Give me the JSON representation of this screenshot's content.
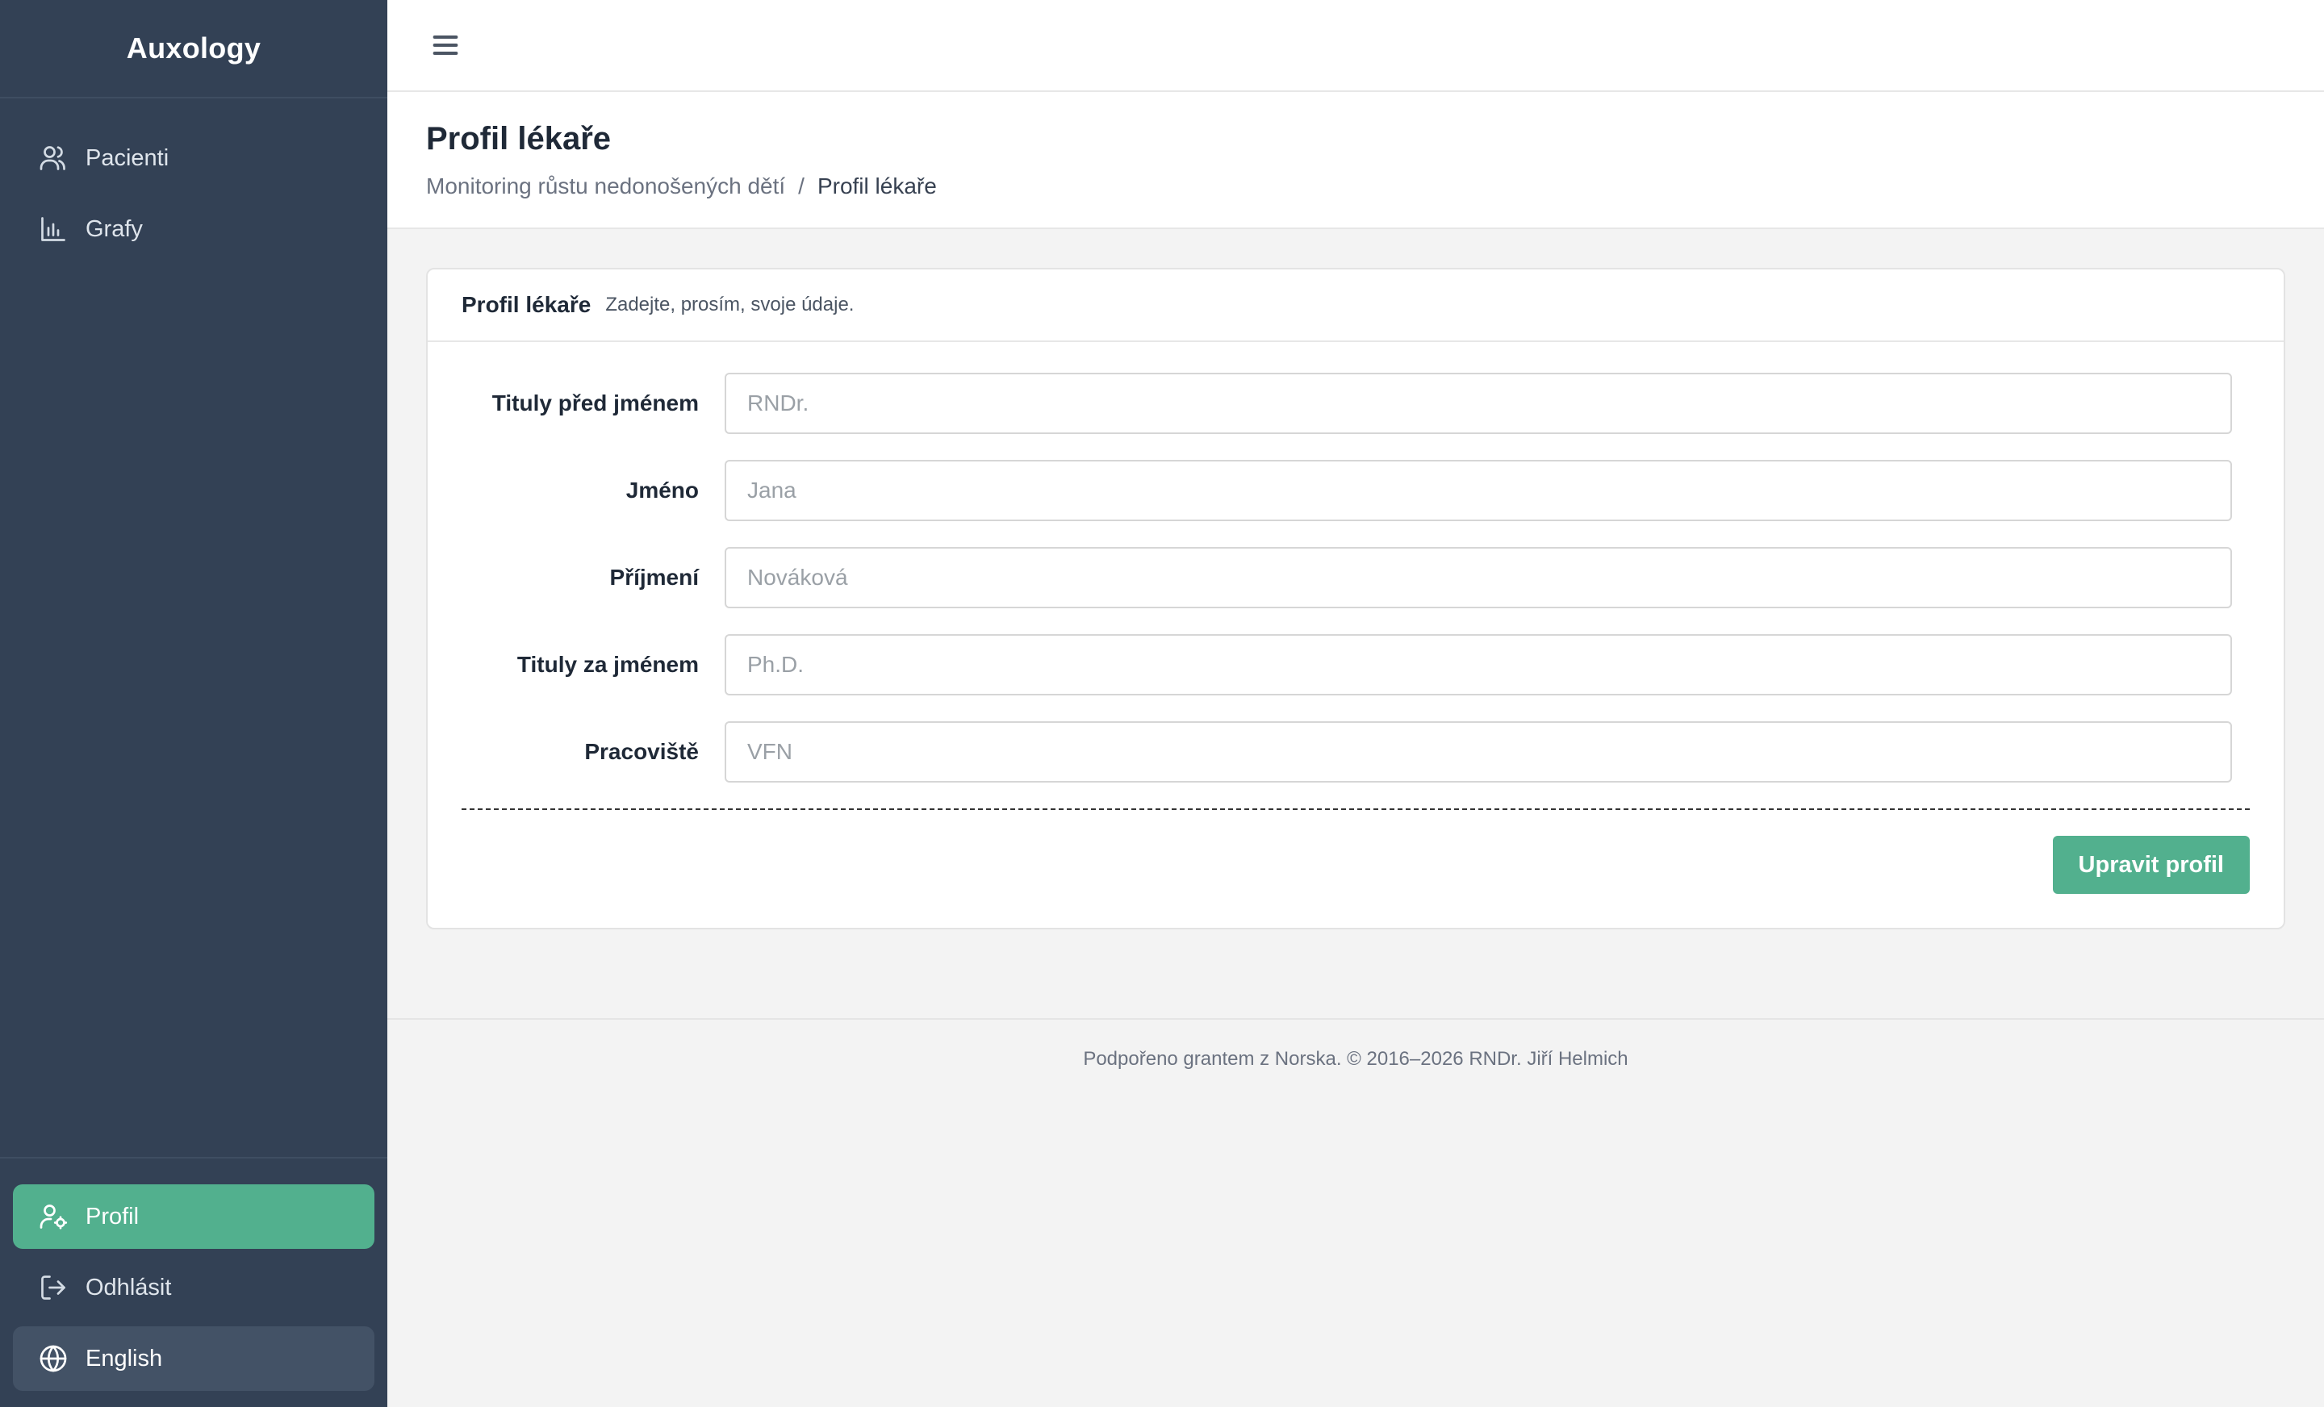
{
  "app": {
    "title": "Auxology"
  },
  "sidebar": {
    "top_items": [
      {
        "label": "Pacienti",
        "icon": "users-icon"
      },
      {
        "label": "Grafy",
        "icon": "bar-chart-icon"
      }
    ],
    "bottom_items": [
      {
        "label": "Profil",
        "icon": "user-cog-icon",
        "active": true
      },
      {
        "label": "Odhlásit",
        "icon": "logout-icon"
      },
      {
        "label": "English",
        "icon": "globe-icon"
      }
    ]
  },
  "header": {
    "title": "Profil lékaře",
    "breadcrumb": {
      "parent": "Monitoring růstu nedonošených dětí",
      "separator": "/",
      "current": "Profil lékaře"
    }
  },
  "card": {
    "title": "Profil lékaře",
    "subtitle": "Zadejte, prosím, svoje údaje.",
    "fields": [
      {
        "label": "Tituly před jménem",
        "value": "",
        "placeholder": "RNDr."
      },
      {
        "label": "Jméno",
        "value": "",
        "placeholder": "Jana"
      },
      {
        "label": "Příjmení",
        "value": "",
        "placeholder": "Nováková"
      },
      {
        "label": "Tituly za jménem",
        "value": "",
        "placeholder": "Ph.D."
      },
      {
        "label": "Pracoviště",
        "value": "",
        "placeholder": "VFN"
      }
    ],
    "submit_label": "Upravit profil"
  },
  "footer": {
    "text": "Podpořeno grantem z Norska. © 2016–2026 RNDr. Jiří Helmich"
  },
  "colors": {
    "sidebar": "#334155",
    "accent": "#52b08e",
    "background": "#f3f3f3"
  }
}
